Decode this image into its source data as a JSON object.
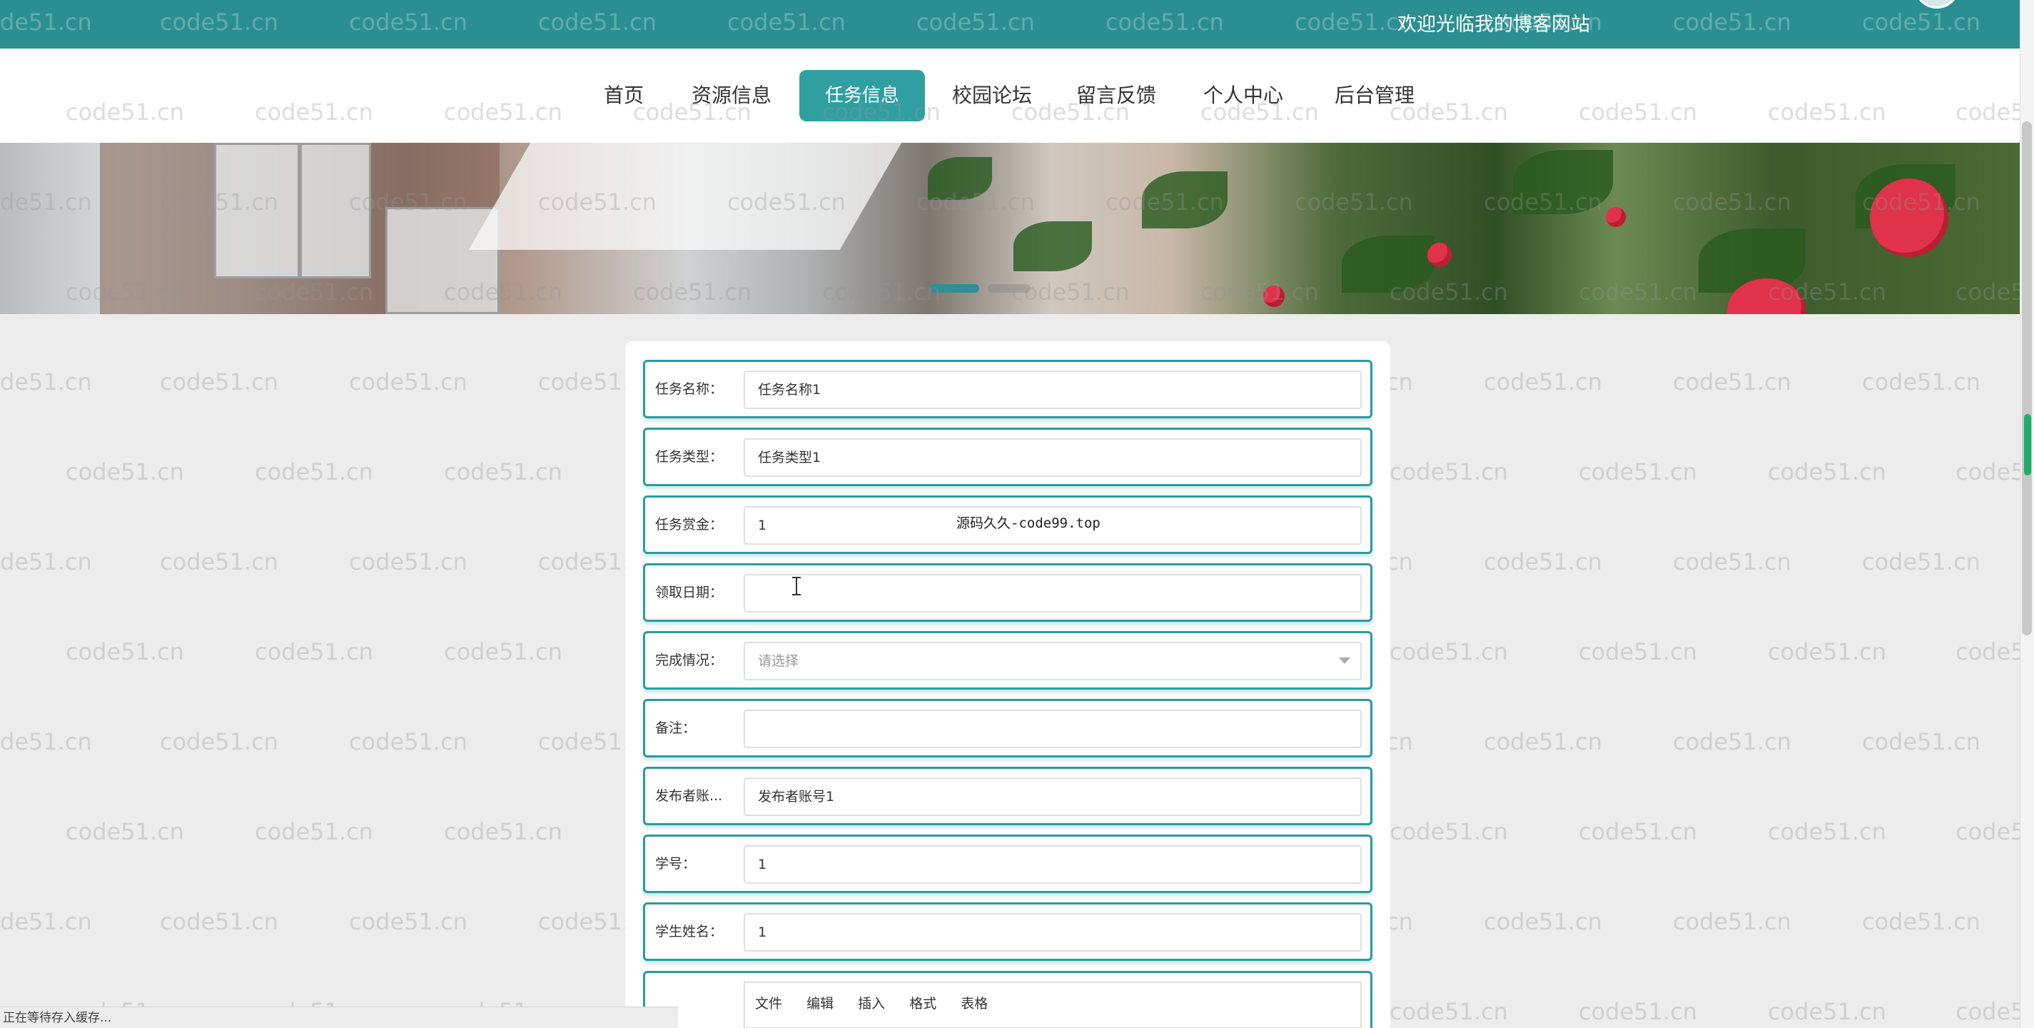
{
  "header": {
    "welcome_text": "欢迎光临我的博客网站",
    "brand_color": "#2b8f92"
  },
  "nav": {
    "items": [
      {
        "label": "首页",
        "active": false
      },
      {
        "label": "资源信息",
        "active": false
      },
      {
        "label": "任务信息",
        "active": true
      },
      {
        "label": "校园论坛",
        "active": false
      },
      {
        "label": "留言反馈",
        "active": false
      },
      {
        "label": "个人中心",
        "active": false
      },
      {
        "label": "后台管理",
        "active": false
      }
    ],
    "active_color": "#2f9fa2"
  },
  "banner": {
    "slide_index": 1,
    "slide_count": 2
  },
  "form": {
    "fields": [
      {
        "label": "任务名称：",
        "value": "任务名称1",
        "placeholder": ""
      },
      {
        "label": "任务类型：",
        "value": "任务类型1",
        "placeholder": ""
      },
      {
        "label": "任务赏金：",
        "value": "1",
        "placeholder": ""
      },
      {
        "label": "领取日期：",
        "value": "",
        "placeholder": ""
      },
      {
        "label": "完成情况：",
        "value": "",
        "placeholder": "请选择",
        "type": "select"
      },
      {
        "label": "备注：",
        "value": "",
        "placeholder": ""
      },
      {
        "label": "发布者账...",
        "value": "发布者账号1",
        "placeholder": ""
      },
      {
        "label": "学号：",
        "value": "1",
        "placeholder": ""
      },
      {
        "label": "学生姓名：",
        "value": "1",
        "placeholder": ""
      }
    ],
    "overlay_text": "源码久久-code99.top",
    "editor_menu": [
      "文件",
      "编辑",
      "插入",
      "格式",
      "表格"
    ],
    "border_color": "#2c9aa0"
  },
  "watermark": "code51.cn",
  "watermark_partial_left": "de51.cn",
  "watermark_partial_right": "code5",
  "status": {
    "text": "正在等待存入缓存..."
  }
}
